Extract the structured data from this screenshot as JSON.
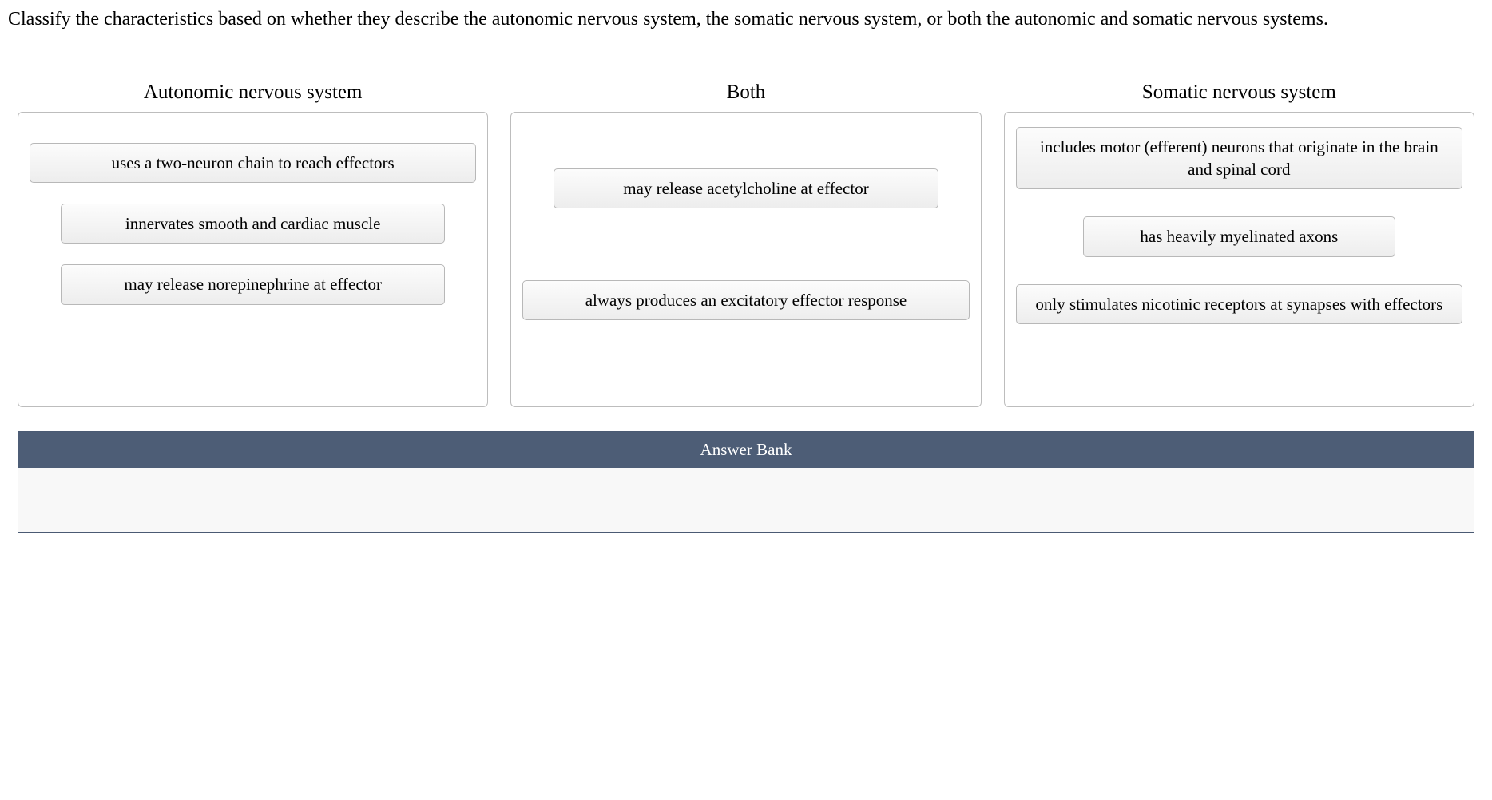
{
  "question": "Classify the characteristics based on whether they describe the autonomic nervous system, the somatic nervous system, or both the autonomic and somatic nervous systems.",
  "columns": {
    "autonomic": {
      "title": "Autonomic nervous system"
    },
    "both": {
      "title": "Both"
    },
    "somatic": {
      "title": "Somatic nervous system"
    }
  },
  "cards": {
    "two_neuron": "uses a two-neuron chain to reach effectors",
    "smooth_cardiac": "innervates smooth and cardiac muscle",
    "norepinephrine": "may release norepinephrine at effector",
    "acetylcholine": "may release acetylcholine at effector",
    "excitatory": "always produces an excitatory effector response",
    "motor_efferent": "includes motor (efferent) neurons that originate in the brain and spinal cord",
    "myelinated": "has heavily myelinated axons",
    "nicotinic": "only stimulates nicotinic receptors at synapses with effectors"
  },
  "answer_bank": {
    "title": "Answer Bank"
  }
}
